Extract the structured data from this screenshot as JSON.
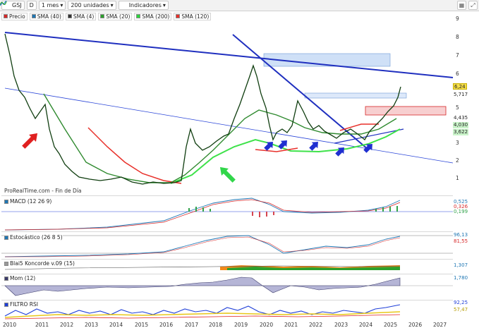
{
  "toolbar": {
    "symbol": "GSJ",
    "timeframe_code": "D",
    "period": "1 mes",
    "units": "200 unidades",
    "indicators_label": "Indicadores"
  },
  "indicator_toggles": [
    {
      "label": "Precio",
      "color": "#d62728"
    },
    {
      "label": "SMA (40)",
      "color": "#1f77b4"
    },
    {
      "label": "SMA (4)",
      "color": "#333333"
    },
    {
      "label": "SMA (20)",
      "color": "#2ca02c"
    },
    {
      "label": "SMA (200)",
      "color": "#2bd63b"
    },
    {
      "label": "SMA (120)",
      "color": "#e8302a"
    }
  ],
  "price_axis": {
    "ticks": [
      "9",
      "8",
      "7",
      "6",
      "5",
      "4",
      "3",
      "2",
      "1"
    ],
    "tags": [
      {
        "text": "6,24",
        "color": "#f7e04b"
      },
      {
        "text": "5,717",
        "color": "#ffffff"
      },
      {
        "text": "4,435",
        "color": "#ffffff"
      },
      {
        "text": "4,030",
        "color": "#c9f3c9"
      },
      {
        "text": "3,622",
        "color": "#c9f3c9"
      }
    ]
  },
  "caption": "ProRealTime.com - Fin de Día",
  "panels": [
    {
      "title": "MACD (12 26 9)",
      "values": [
        "0,525",
        "0,326",
        "0,199"
      ]
    },
    {
      "title": "Estocástico (26 8 5)",
      "values": [
        "96,13",
        "81,55"
      ]
    },
    {
      "title": "Blai5 Koncorde v.09 (15)",
      "values": [
        "1,307"
      ]
    },
    {
      "title": "Mom (12)",
      "values": [
        "1,780"
      ]
    },
    {
      "title": "FILTRO RSI",
      "values": [
        "92,25",
        "57,47"
      ]
    }
  ],
  "x_axis": {
    "years": [
      "2010",
      "2011",
      "2012",
      "2013",
      "2014",
      "2015",
      "2016",
      "2017",
      "2018",
      "2019",
      "2020",
      "2021",
      "2022",
      "2023",
      "2024",
      "2025",
      "2026",
      "2027"
    ]
  },
  "chart_data": {
    "type": "line",
    "title": "GSJ",
    "xlabel": "",
    "ylabel": "",
    "ylim": [
      0.5,
      9.5
    ],
    "series": [
      {
        "name": "Precio",
        "x": [
          2010.0,
          2010.5,
          2011.0,
          2011.5,
          2012.0,
          2013.0,
          2014.0,
          2015.0,
          2016.0,
          2016.5,
          2017.0,
          2017.5,
          2018.0,
          2018.5,
          2019.0,
          2019.5,
          2020.0,
          2020.5,
          2021.0,
          2021.5,
          2022.0,
          2022.5,
          2023.0,
          2023.5,
          2024.0,
          2024.5,
          2025.0,
          2025.3
        ],
        "values": [
          9.0,
          6.0,
          4.3,
          3.2,
          1.6,
          1.2,
          1.1,
          0.8,
          1.0,
          1.2,
          2.3,
          3.2,
          3.4,
          4.5,
          6.2,
          7.6,
          5.8,
          3.5,
          4.0,
          3.3,
          4.5,
          3.8,
          3.2,
          3.4,
          3.5,
          4.0,
          5.3,
          6.24
        ]
      }
    ]
  }
}
